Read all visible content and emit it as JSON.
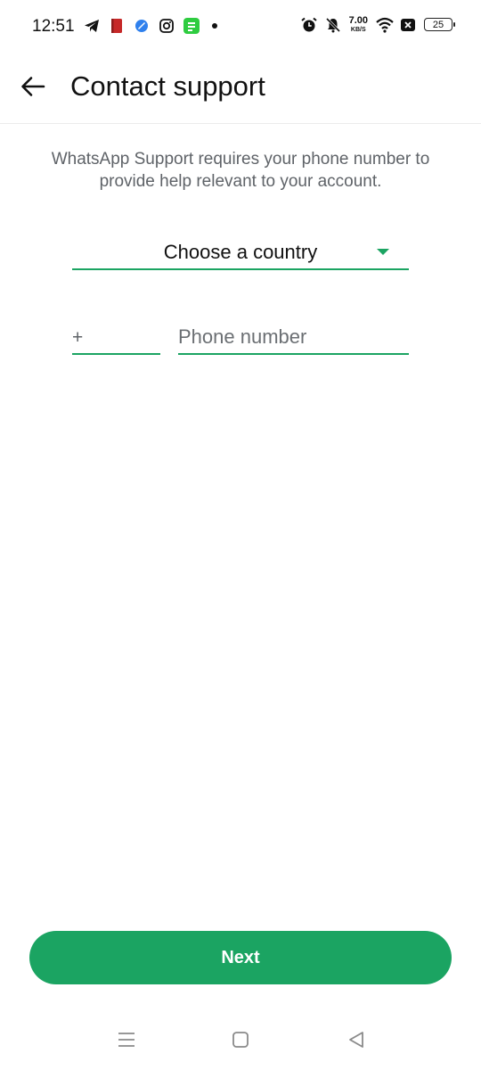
{
  "status_bar": {
    "time": "12:51",
    "net_speed_value": "7.00",
    "net_speed_unit": "KB/S",
    "battery": "25"
  },
  "header": {
    "title": "Contact support"
  },
  "main": {
    "description": "WhatsApp Support requires your phone number to provide help relevant to your account.",
    "country_select_label": "Choose a country",
    "country_code_prefix": "+",
    "country_code_value": "",
    "phone_placeholder": "Phone number",
    "phone_value": ""
  },
  "footer": {
    "next_label": "Next"
  },
  "colors": {
    "accent": "#1ba462"
  }
}
